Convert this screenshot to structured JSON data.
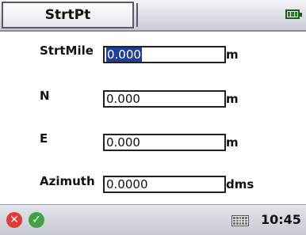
{
  "header": {
    "tab_label": "StrtPt",
    "battery_icon": "battery-icon"
  },
  "form": {
    "fields": [
      {
        "label": "StrtMile",
        "value": "0.000",
        "unit": "m"
      },
      {
        "label": "N",
        "value": "0.000",
        "unit": "m"
      },
      {
        "label": "E",
        "value": "0.000",
        "unit": "m"
      },
      {
        "label": "Azimuth",
        "value": "0.0000",
        "unit": "dms"
      }
    ]
  },
  "footer": {
    "cancel_icon": "close-icon",
    "ok_icon": "check-icon",
    "keyboard_icon": "keyboard-icon",
    "time": "10:45"
  },
  "colors": {
    "selection": "#1f3f9c",
    "cancel": "#e53935",
    "ok": "#43a047",
    "battery": "#2e7d32"
  }
}
